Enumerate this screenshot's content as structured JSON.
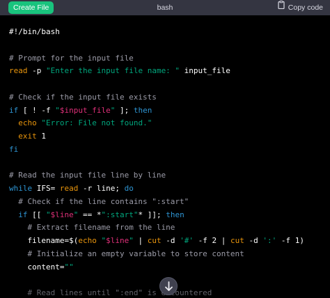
{
  "header": {
    "create_button": "Create File",
    "language": "bash",
    "copy_label": "Copy code"
  },
  "code": {
    "lines": [
      [
        {
          "t": "#!/bin/bash",
          "c": "p"
        }
      ],
      [],
      [
        {
          "t": "# Prompt for the input file",
          "c": "c"
        }
      ],
      [
        {
          "t": "read",
          "c": "b"
        },
        {
          "t": " -p ",
          "c": "p"
        },
        {
          "t": "\"Enter the input file name: \"",
          "c": "s"
        },
        {
          "t": " input_file",
          "c": "p"
        }
      ],
      [],
      [
        {
          "t": "# Check if the input file exists",
          "c": "c"
        }
      ],
      [
        {
          "t": "if",
          "c": "k"
        },
        {
          "t": " [ ! -f ",
          "c": "p"
        },
        {
          "t": "\"",
          "c": "s"
        },
        {
          "t": "$input_file",
          "c": "v"
        },
        {
          "t": "\"",
          "c": "s"
        },
        {
          "t": " ]; ",
          "c": "p"
        },
        {
          "t": "then",
          "c": "k"
        }
      ],
      [
        {
          "t": "  ",
          "c": "p"
        },
        {
          "t": "echo",
          "c": "b"
        },
        {
          "t": " ",
          "c": "p"
        },
        {
          "t": "\"Error: File not found.\"",
          "c": "s"
        }
      ],
      [
        {
          "t": "  ",
          "c": "p"
        },
        {
          "t": "exit",
          "c": "b"
        },
        {
          "t": " 1",
          "c": "p"
        }
      ],
      [
        {
          "t": "fi",
          "c": "k"
        }
      ],
      [],
      [
        {
          "t": "# Read the input file line by line",
          "c": "c"
        }
      ],
      [
        {
          "t": "while",
          "c": "k"
        },
        {
          "t": " IFS= ",
          "c": "p"
        },
        {
          "t": "read",
          "c": "b"
        },
        {
          "t": " -r line; ",
          "c": "p"
        },
        {
          "t": "do",
          "c": "k"
        }
      ],
      [
        {
          "t": "  ",
          "c": "p"
        },
        {
          "t": "# Check if the line contains \":start\"",
          "c": "c"
        }
      ],
      [
        {
          "t": "  ",
          "c": "p"
        },
        {
          "t": "if",
          "c": "k"
        },
        {
          "t": " [[ ",
          "c": "p"
        },
        {
          "t": "\"",
          "c": "s"
        },
        {
          "t": "$line",
          "c": "v"
        },
        {
          "t": "\"",
          "c": "s"
        },
        {
          "t": " == *",
          "c": "p"
        },
        {
          "t": "\":start\"",
          "c": "s"
        },
        {
          "t": "* ]]; ",
          "c": "p"
        },
        {
          "t": "then",
          "c": "k"
        }
      ],
      [
        {
          "t": "    ",
          "c": "p"
        },
        {
          "t": "# Extract filename from the line",
          "c": "c"
        }
      ],
      [
        {
          "t": "    filename=$(",
          "c": "p"
        },
        {
          "t": "echo",
          "c": "b"
        },
        {
          "t": " ",
          "c": "p"
        },
        {
          "t": "\"",
          "c": "s"
        },
        {
          "t": "$line",
          "c": "v"
        },
        {
          "t": "\"",
          "c": "s"
        },
        {
          "t": " | ",
          "c": "p"
        },
        {
          "t": "cut",
          "c": "b"
        },
        {
          "t": " -d ",
          "c": "p"
        },
        {
          "t": "'#'",
          "c": "s"
        },
        {
          "t": " -f 2 | ",
          "c": "p"
        },
        {
          "t": "cut",
          "c": "b"
        },
        {
          "t": " -d ",
          "c": "p"
        },
        {
          "t": "':'",
          "c": "s"
        },
        {
          "t": " -f 1)",
          "c": "p"
        }
      ],
      [
        {
          "t": "    ",
          "c": "p"
        },
        {
          "t": "# Initialize an empty variable to store content",
          "c": "c"
        }
      ],
      [
        {
          "t": "    content=",
          "c": "p"
        },
        {
          "t": "\"\"",
          "c": "s"
        }
      ],
      [],
      [
        {
          "t": "    ",
          "c": "p"
        },
        {
          "t": "# Read lines until \":end\" is encountered",
          "c": "c"
        }
      ]
    ]
  },
  "icons": {
    "copy": "clipboard-icon",
    "scroll": "arrow-down-icon"
  },
  "colors": {
    "background": "#000000",
    "header": "#343541",
    "accent_button": "#19c37d",
    "comment": "#9b9ba7",
    "keyword": "#2e95d3",
    "string": "#00a67d",
    "builtin": "#e9950c",
    "variable": "#df3079"
  }
}
